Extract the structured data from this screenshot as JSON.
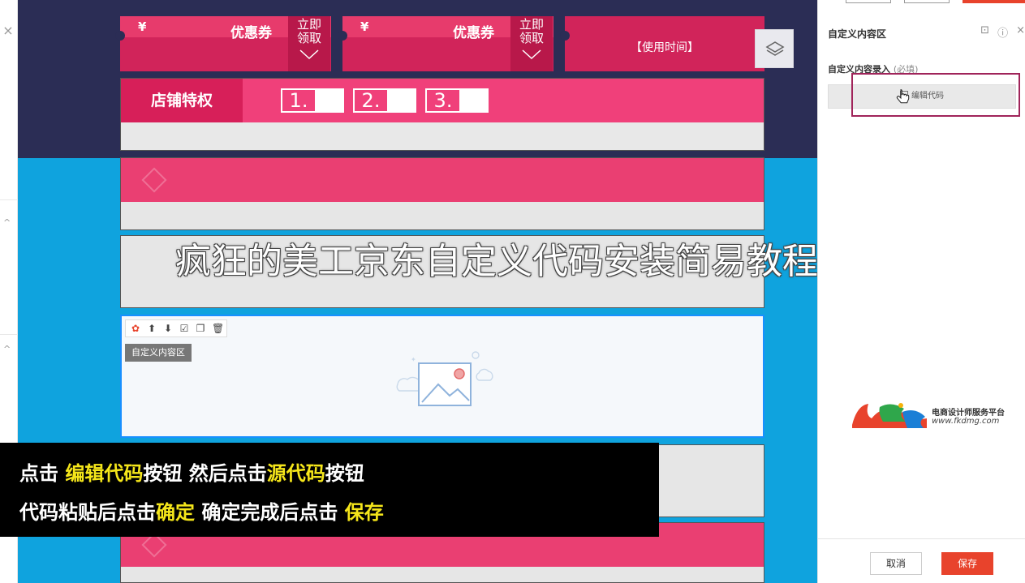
{
  "canvas": {
    "coupons": [
      {
        "yen": "¥",
        "title": "优惠券",
        "claim": [
          "立即",
          "领取"
        ]
      },
      {
        "yen": "¥",
        "title": "优惠券",
        "claim": [
          "立即",
          "领取"
        ]
      },
      {
        "use_time": "【使用时间】"
      }
    ],
    "privilege": {
      "label": "店铺特权",
      "items": [
        "1.",
        "2.",
        "3."
      ]
    },
    "selected_module": {
      "tag": "自定义内容区"
    },
    "overlay_title": "疯狂的美工京东自定义代码安装简易教程"
  },
  "caption": {
    "line1": {
      "a": "点击 ",
      "b": "编辑代码",
      "c": "按钮 然后点击",
      "d": "源代码",
      "e": "按钮"
    },
    "line2": {
      "a": "代码粘贴后点击",
      "b": "确定",
      "c": " 确定完成后点击 ",
      "d": "保存"
    }
  },
  "panel": {
    "title": "自定义内容区",
    "field_label": "自定义内容录入",
    "field_required": "(必填)",
    "edit_code_label": "编辑代码",
    "logo_tagline": "电商设计师服务平台",
    "logo_url": "www.fkdmg.com",
    "cancel_label": "取消",
    "save_label": "保存"
  },
  "colors": {
    "canvas_blue": "#0fa3de",
    "navy": "#2b2d55",
    "pink": "#e73b6c",
    "accent_red": "#e8432c",
    "highlight_yellow": "#f5e61a"
  }
}
